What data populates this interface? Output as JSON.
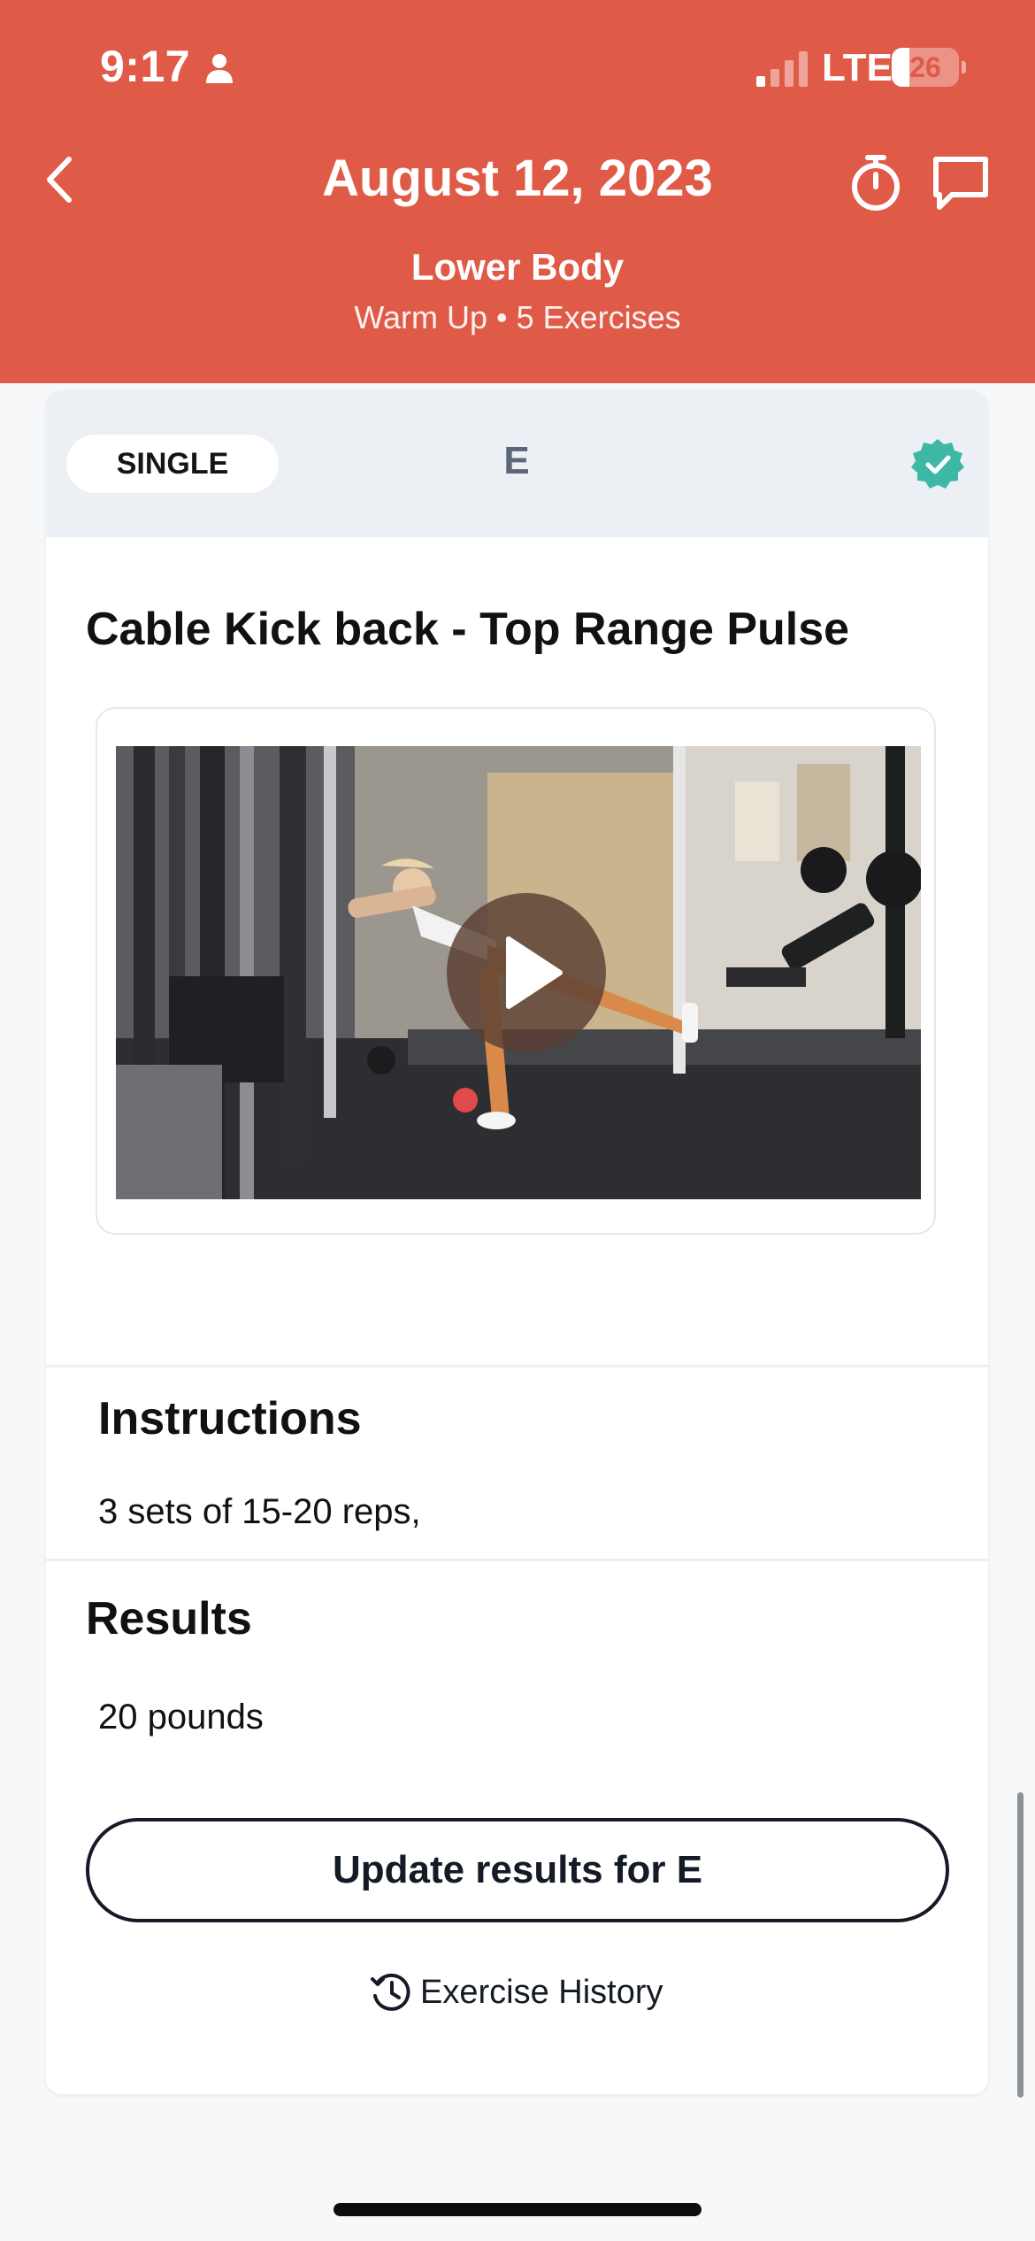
{
  "status_bar": {
    "time": "9:17",
    "network": "LTE",
    "battery": "26",
    "battery_level": 0.26
  },
  "header": {
    "title": "August 12, 2023",
    "workout_name": "Lower Body",
    "workout_meta": "Warm Up • 5 Exercises"
  },
  "block": {
    "type": "SINGLE",
    "letter": "E"
  },
  "exercise": {
    "title": "Cable Kick back - Top Range Pulse"
  },
  "instructions": {
    "heading": "Instructions",
    "text": "3 sets of 15-20 reps,"
  },
  "results": {
    "heading": "Results",
    "value": "20 pounds"
  },
  "actions": {
    "update_label": "Update results for E",
    "history_label": "Exercise History"
  },
  "colors": {
    "header": "#e05a48",
    "badge": "#3db8a6",
    "button_border": "#151b26",
    "letter": "#5b6678"
  }
}
